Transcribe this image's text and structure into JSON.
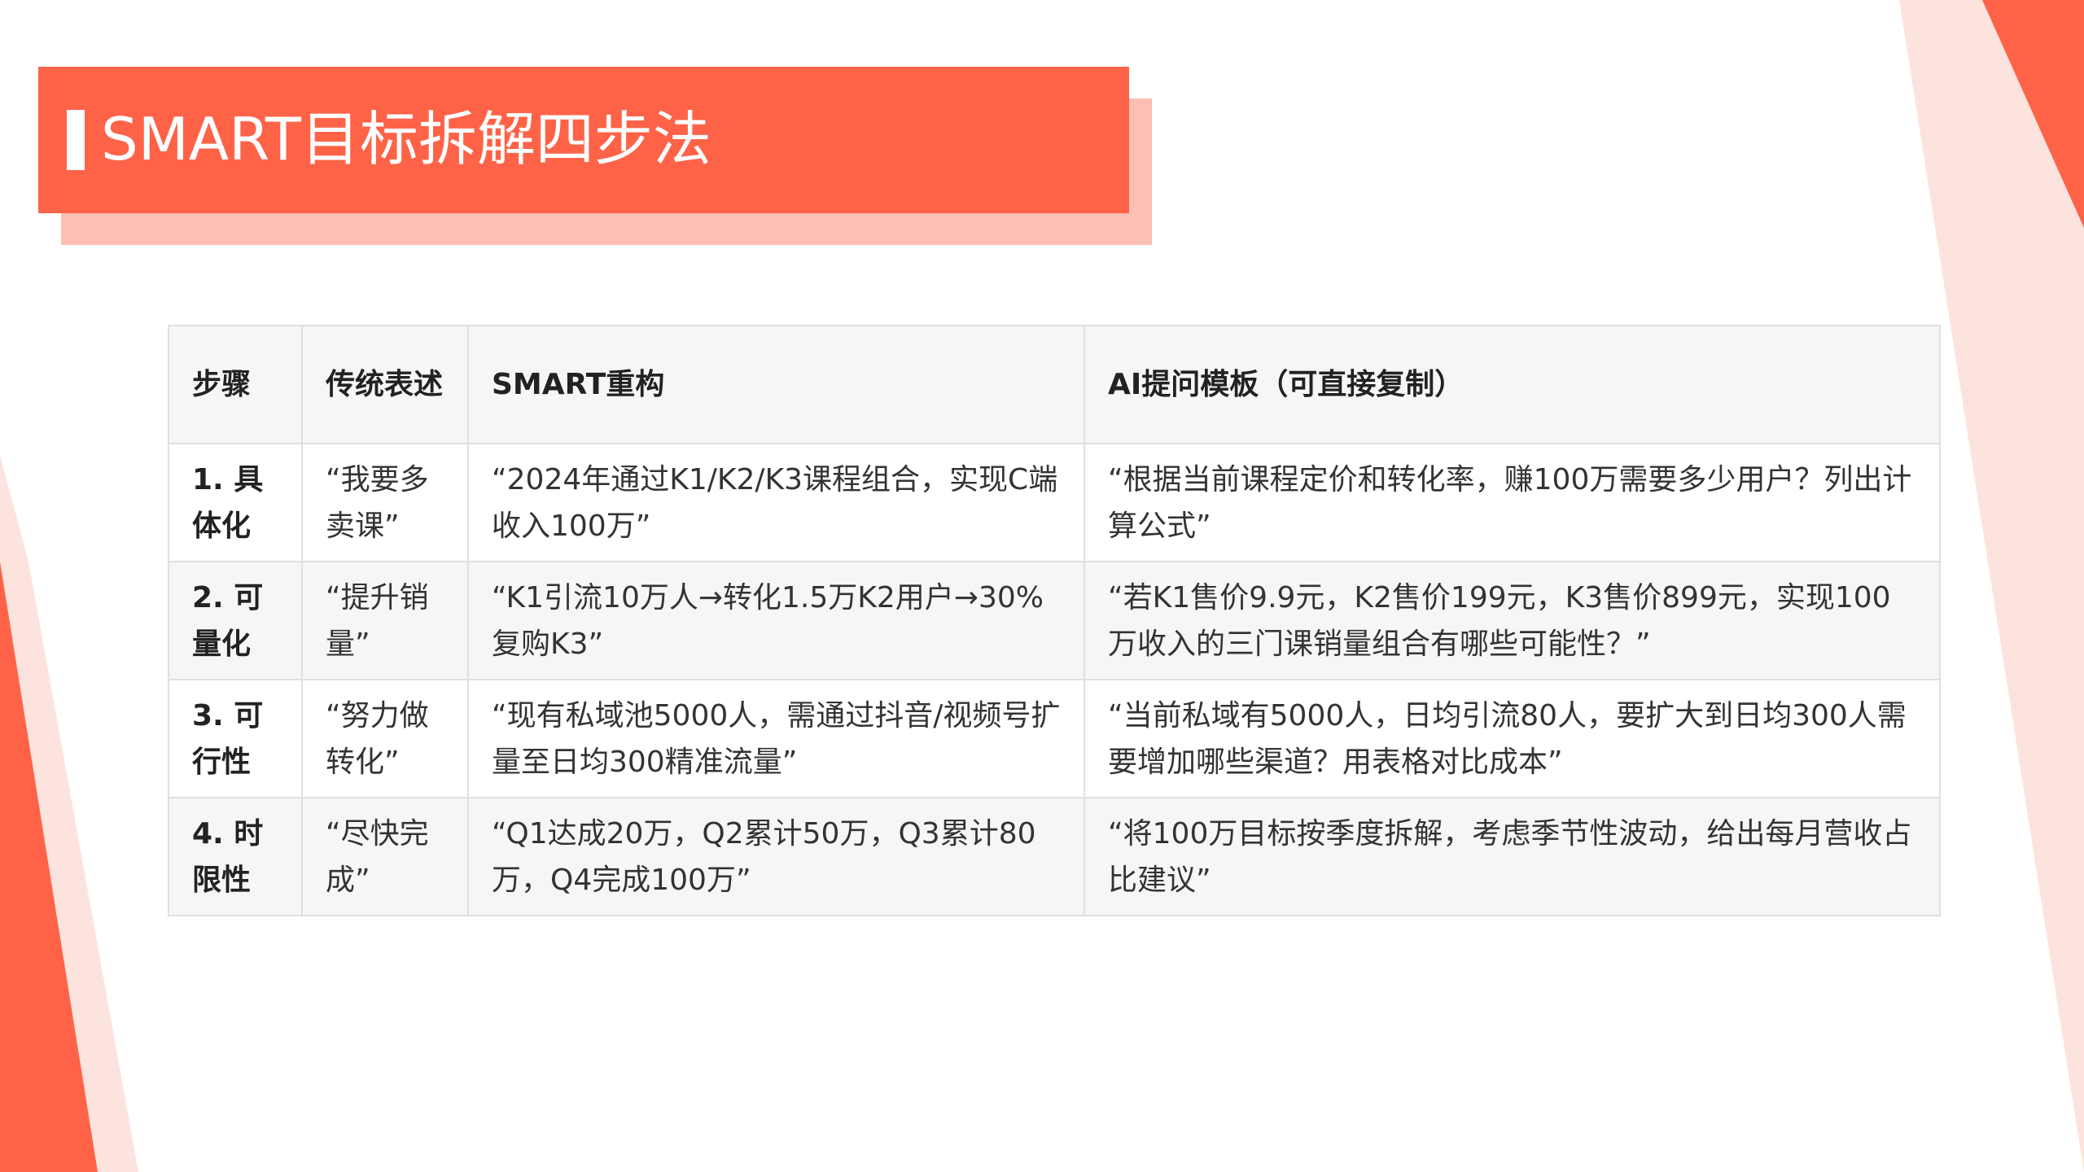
{
  "slide": {
    "title": "SMART目标拆解四步法",
    "colors": {
      "accent": "#fe6348",
      "accent_light": "#fbbfb4",
      "accent_pale": "#fde3de",
      "header_bg": "#f6f6f6",
      "border": "#e0e0e0"
    }
  },
  "table": {
    "headers": [
      "步骤",
      "传统表述",
      "SMART重构",
      "AI提问模板（可直接复制）"
    ],
    "rows": [
      {
        "step": "1. 具体化",
        "traditional": "“我要多卖课”",
        "smart": "“2024年通过K1/K2/K3课程组合，实现C端收入100万”",
        "ai_prompt": "“根据当前课程定价和转化率，赚100万需要多少用户？列出计算公式”"
      },
      {
        "step": "2. 可量化",
        "traditional": "“提升销量”",
        "smart": "“K1引流10万人→转化1.5万K2用户→30%复购K3”",
        "ai_prompt": "“若K1售价9.9元，K2售价199元，K3售价899元，实现100万收入的三门课销量组合有哪些可能性？”"
      },
      {
        "step": "3. 可行性",
        "traditional": "“努力做转化”",
        "smart": "“现有私域池5000人，需通过抖音/视频号扩量至日均300精准流量”",
        "ai_prompt": "“当前私域有5000人，日均引流80人，要扩大到日均300人需要增加哪些渠道？用表格对比成本”"
      },
      {
        "step": "4. 时限性",
        "traditional": "“尽快完成”",
        "smart": "“Q1达成20万，Q2累计50万，Q3累计80万，Q4完成100万”",
        "ai_prompt": "“将100万目标按季度拆解，考虑季节性波动，给出每月营收占比建议”"
      }
    ]
  }
}
